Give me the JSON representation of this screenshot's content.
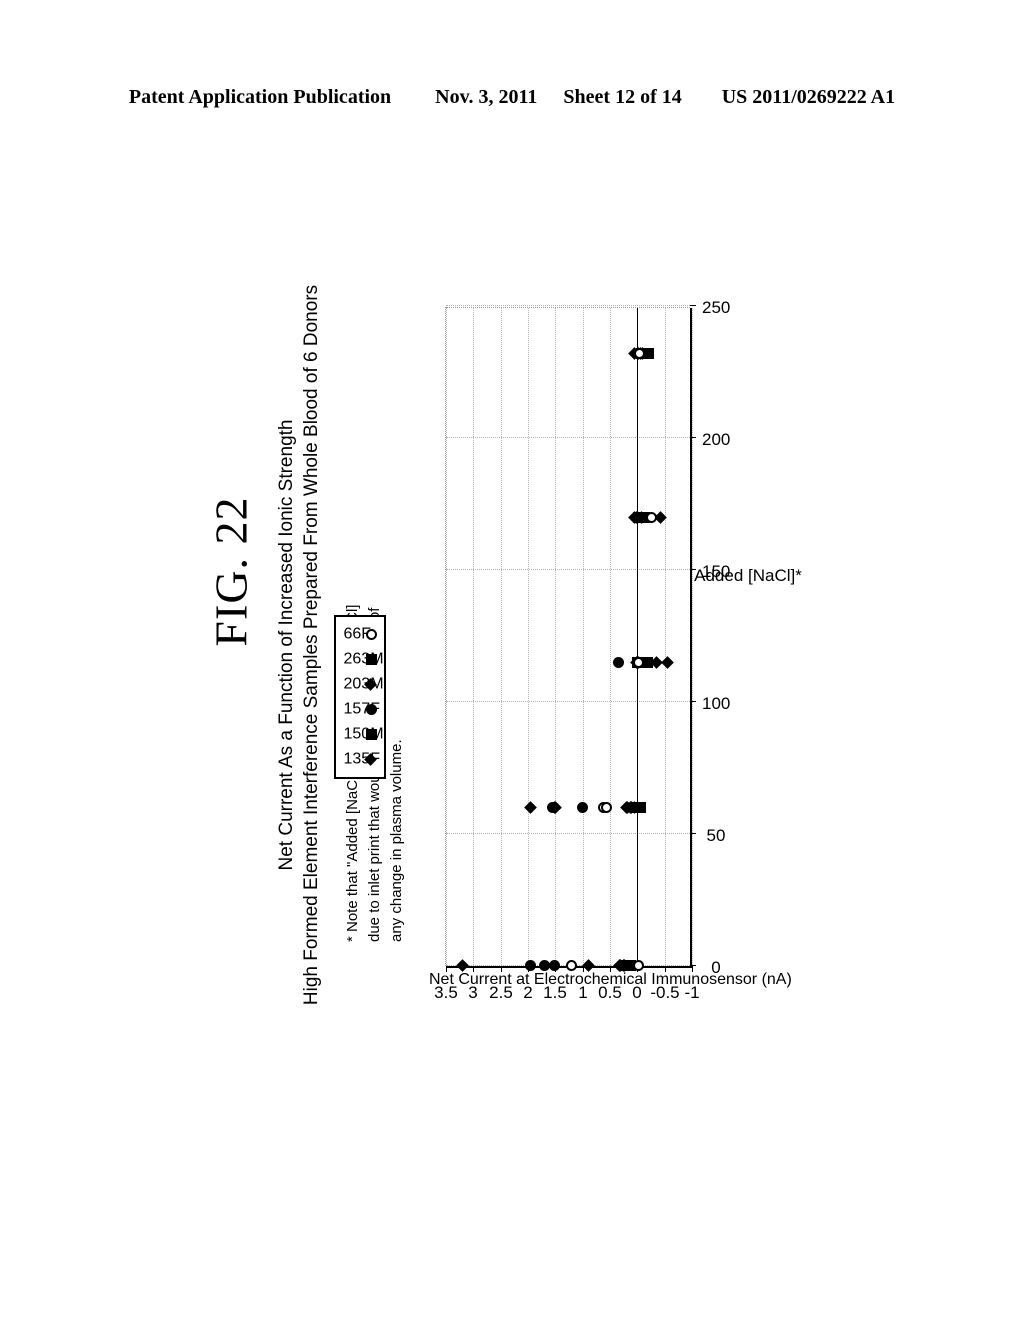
{
  "patent_header": {
    "publication": "Patent Application Publication",
    "date": "Nov. 3, 2011",
    "sheet": "Sheet 12 of 14",
    "number": "US 2011/0269222 A1"
  },
  "figure": {
    "label": "FIG. 22"
  },
  "note": {
    "line1": "* Note that \"Added [NaCl]\" is the increase in [NaCl]",
    "line2": "due to inlet print that would arise in the absence of",
    "line3": "any change in plasma volume."
  },
  "chart_data": {
    "type": "scatter",
    "title": "Net Current As a Function of Increased Ionic Strength",
    "subtitle": "High Formed Element Interference Samples Prepared From Whole Blood of 6 Donors",
    "xlabel": "Added [NaCl]*",
    "ylabel": "Net Current at Electrochemical Immunosensor (nA)",
    "xlim": [
      0,
      250
    ],
    "ylim": [
      -1,
      3.5
    ],
    "xticks": [
      0,
      50,
      100,
      150,
      200,
      250
    ],
    "xtick_labels": [
      "0",
      "50",
      "100",
      "150",
      "200",
      "250"
    ],
    "yticks": [
      -1,
      -0.5,
      0,
      0.5,
      1,
      1.5,
      2,
      2.5,
      3,
      3.5
    ],
    "ytick_labels": [
      "-1",
      "-0.5",
      "0",
      "0.5",
      "1",
      "1.5",
      "2",
      "2.5",
      "3",
      "3.5"
    ],
    "grid": true,
    "zero_line": true,
    "legend_position": "top-left-inside",
    "series": [
      {
        "name": "135F",
        "marker": "diamond",
        "filled": true,
        "points": [
          [
            0,
            3.2
          ],
          [
            0,
            0.9
          ],
          [
            0,
            0.32
          ],
          [
            0,
            0.26
          ],
          [
            60,
            1.95
          ],
          [
            60,
            1.5
          ],
          [
            60,
            0.2
          ],
          [
            60,
            0.12
          ],
          [
            60,
            0.06
          ],
          [
            115,
            -0.35
          ],
          [
            115,
            -0.55
          ],
          [
            115,
            0.02
          ],
          [
            170,
            0.06
          ],
          [
            170,
            -0.42
          ],
          [
            170,
            0.0
          ],
          [
            232,
            0.05
          ],
          [
            232,
            -0.02
          ]
        ]
      },
      {
        "name": "150M",
        "marker": "square",
        "filled": true,
        "points": [
          [
            0,
            0.2
          ],
          [
            0,
            0.16
          ],
          [
            60,
            0.04
          ],
          [
            60,
            -0.02
          ],
          [
            115,
            0.0
          ],
          [
            115,
            -0.04
          ],
          [
            115,
            -0.08
          ],
          [
            115,
            -0.12
          ],
          [
            170,
            -0.02
          ],
          [
            170,
            -0.06
          ],
          [
            232,
            -0.08
          ],
          [
            232,
            -0.12
          ],
          [
            232,
            -0.16
          ]
        ]
      },
      {
        "name": "157F",
        "marker": "circle",
        "filled": true,
        "points": [
          [
            0,
            1.95
          ],
          [
            0,
            1.7
          ],
          [
            0,
            1.52
          ],
          [
            60,
            1.55
          ],
          [
            60,
            1.0
          ],
          [
            115,
            0.35
          ],
          [
            170,
            -0.04
          ],
          [
            232,
            -0.04
          ]
        ]
      },
      {
        "name": "203M",
        "marker": "diamond",
        "filled": true,
        "points": [
          [
            0,
            0.3
          ],
          [
            0,
            0.24
          ],
          [
            60,
            1.52
          ],
          [
            60,
            0.18
          ],
          [
            60,
            0.1
          ],
          [
            115,
            -0.02
          ],
          [
            170,
            0.02
          ],
          [
            170,
            -0.08
          ],
          [
            232,
            -0.06
          ],
          [
            232,
            -0.1
          ]
        ]
      },
      {
        "name": "263M",
        "marker": "square",
        "filled": true,
        "points": [
          [
            0,
            0.18
          ],
          [
            0,
            0.12
          ],
          [
            60,
            0.0
          ],
          [
            60,
            -0.06
          ],
          [
            115,
            -0.06
          ],
          [
            115,
            -0.1
          ],
          [
            115,
            -0.14
          ],
          [
            115,
            -0.18
          ],
          [
            170,
            -0.1
          ],
          [
            170,
            -0.14
          ],
          [
            232,
            -0.14
          ],
          [
            232,
            -0.18
          ],
          [
            232,
            -0.2
          ]
        ]
      },
      {
        "name": "66F",
        "marker": "circle",
        "filled": false,
        "points": [
          [
            0,
            1.2
          ],
          [
            0,
            -0.02
          ],
          [
            60,
            0.62
          ],
          [
            60,
            0.56
          ],
          [
            115,
            -0.02
          ],
          [
            170,
            -0.25
          ],
          [
            232,
            -0.04
          ]
        ]
      }
    ]
  },
  "legend": {
    "items": [
      {
        "label": "135F",
        "marker": "diamond",
        "filled": true
      },
      {
        "label": "150M",
        "marker": "square",
        "filled": true
      },
      {
        "label": "157F",
        "marker": "circle",
        "filled": true
      },
      {
        "label": "203M",
        "marker": "diamond",
        "filled": true
      },
      {
        "label": "263M",
        "marker": "square",
        "filled": true
      },
      {
        "label": "66F",
        "marker": "circle",
        "filled": false
      }
    ]
  },
  "colors": {
    "ink": "#000000",
    "paper": "#ffffff",
    "grid": "#b4b4b4"
  }
}
